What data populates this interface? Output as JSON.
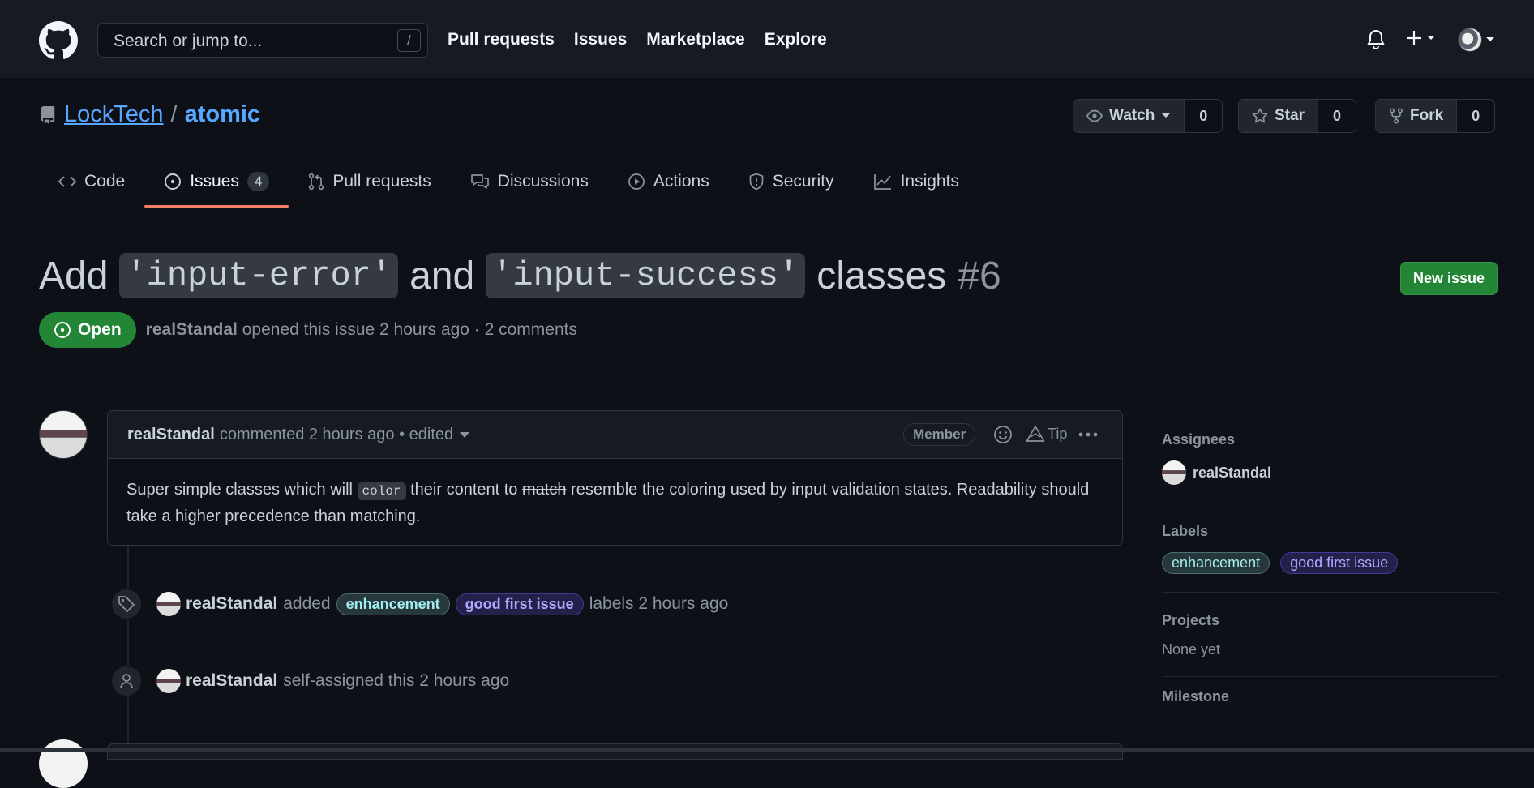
{
  "header": {
    "search_placeholder": "Search or jump to...",
    "search_shortcut": "/",
    "nav": [
      "Pull requests",
      "Issues",
      "Marketplace",
      "Explore"
    ]
  },
  "repo": {
    "owner": "LockTech",
    "separator": "/",
    "name": "atomic",
    "watch_label": "Watch",
    "watch_count": "0",
    "star_label": "Star",
    "star_count": "0",
    "fork_label": "Fork",
    "fork_count": "0"
  },
  "tabs": {
    "code": "Code",
    "issues": "Issues",
    "issues_count": "4",
    "pulls": "Pull requests",
    "discussions": "Discussions",
    "actions": "Actions",
    "security": "Security",
    "insights": "Insights"
  },
  "issue": {
    "title_part1": "Add",
    "code1": "'input-error'",
    "title_part2": "and",
    "code2": "'input-success'",
    "title_part3": "classes",
    "number": "#6",
    "new_issue_label": "New issue",
    "state": "Open",
    "author": "realStandal",
    "meta": "opened this issue 2 hours ago · 2 comments"
  },
  "comment": {
    "author": "realStandal",
    "meta": "commented 2 hours ago • edited",
    "badge": "Member",
    "tip": "Tip",
    "body_1": "Super simple classes which will",
    "body_code": "color",
    "body_2": "their content to",
    "body_strike": "match",
    "body_3": "resemble the coloring used by input validation states. Readability should take a higher precedence than matching."
  },
  "events": [
    {
      "user": "realStandal",
      "pre": "added",
      "labels": [
        "enhancement",
        "good first issue"
      ],
      "post": "labels 2 hours ago"
    },
    {
      "user": "realStandal",
      "text": "self-assigned this 2 hours ago"
    }
  ],
  "sidebar": {
    "assignees_h": "Assignees",
    "assignee": "realStandal",
    "labels_h": "Labels",
    "labels": [
      "enhancement",
      "good first issue"
    ],
    "projects_h": "Projects",
    "projects_val": "None yet",
    "milestone_h": "Milestone"
  },
  "colors": {
    "bg": "#0d1117",
    "header_bg": "#161b22",
    "link": "#58a6ff",
    "open_green": "#238636",
    "tab_underline": "#f78166"
  }
}
